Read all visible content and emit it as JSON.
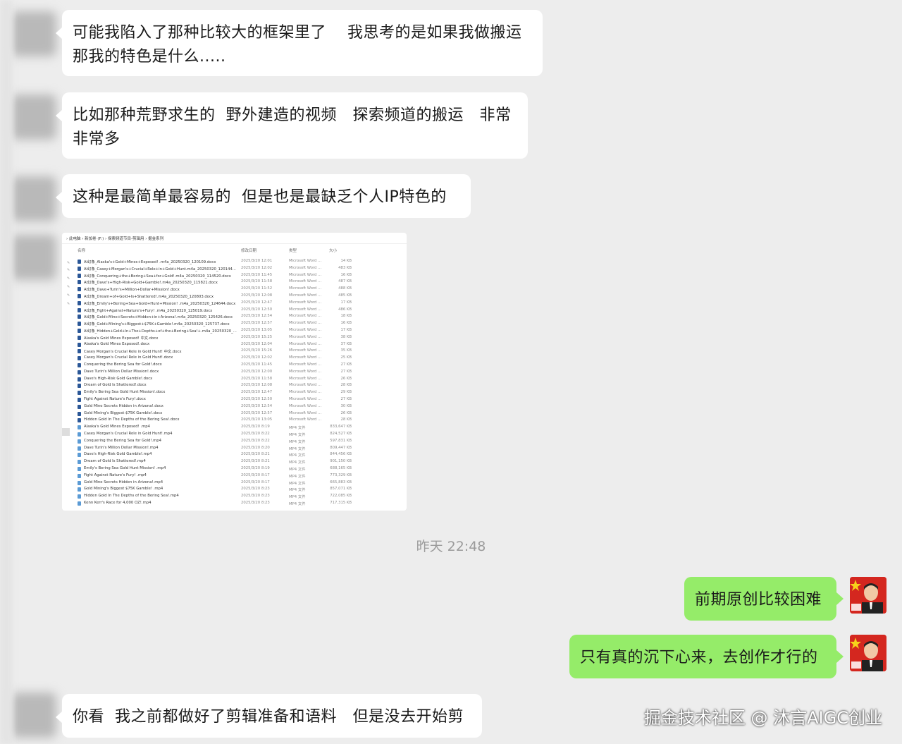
{
  "chat": {
    "messages_left_top": [
      {
        "text": "可能我陷入了那种比较大的框架里了    我思考的是如果我做搬运\n那我的特色是什么....."
      },
      {
        "text": "比如那种荒野求生的  野外建造的视频   探索频道的搬运   非常\n非常多"
      },
      {
        "text": "这种是最简单最容易的  但是也是最缺乏个人IP特色的"
      }
    ],
    "timestamp": "昨天 22:48",
    "messages_right": [
      {
        "text": "前期原创比较困难"
      },
      {
        "text": "只有真的沉下心来，去创作才行的"
      }
    ],
    "message_left_bottom": {
      "text": "你看  我之前都做好了剪辑准备和语料   但是没去开始剪"
    },
    "watermark": "掘金技术社区 @ 沐言AIGC创业"
  },
  "explorer": {
    "breadcrumb": "›  此电脑  ›  新加卷 (F:)  ›  探索频道节目-剪辑用  ›  掘金系列",
    "headers": {
      "name": "名称",
      "date": "修改日期",
      "type": "类型",
      "size": "大小"
    },
    "rows": [
      {
        "name": "AI幻象_Alaska's+Gold+Mines+Exposed! .m4a_20250320_120109.docx",
        "date": "2025/3/20 12:01",
        "type": "Microsoft Word ...",
        "size": "14 KB",
        "kind": "docx"
      },
      {
        "name": "AI幻象_Casey+Morgan's+Crucial+Role+in+Gold+Hunt.m4a_20250320_120144...",
        "date": "2025/3/20 12:02",
        "type": "Microsoft Word ...",
        "size": "483 KB",
        "kind": "docx"
      },
      {
        "name": "AI幻象_Conquering+the+Bering+Sea+for+Gold!.m4a_20250320_114520.docx",
        "date": "2025/3/20 11:45",
        "type": "Microsoft Word ...",
        "size": "16 KB",
        "kind": "docx"
      },
      {
        "name": "AI幻象_Dave's+High-Risk+Gold+Gamble!.m4a_20250320_115821.docx",
        "date": "2025/3/20 11:58",
        "type": "Microsoft Word ...",
        "size": "487 KB",
        "kind": "docx"
      },
      {
        "name": "AI幻象_Dave+Turin's+Million+Dollar+Mission!.docx",
        "date": "2025/3/20 11:52",
        "type": "Microsoft Word ...",
        "size": "488 KB",
        "kind": "docx"
      },
      {
        "name": "AI幻象_Dream+of+Gold+Is+Shattered!.m4a_20250320_120803.docx",
        "date": "2025/3/20 12:08",
        "type": "Microsoft Word ...",
        "size": "485 KB",
        "kind": "docx"
      },
      {
        "name": "AI幻象_Emily's+Bering+Sea+Gold+Hunt+Mission! .m4a_20250320_124644.docx",
        "date": "2025/3/20 12:47",
        "type": "Microsoft Word ...",
        "size": "17 KB",
        "kind": "docx"
      },
      {
        "name": "AI幻象_Fight+Against+Nature's+Fury! .m4a_20250320_125019.docx",
        "date": "2025/3/20 12:50",
        "type": "Microsoft Word ...",
        "size": "486 KB",
        "kind": "docx"
      },
      {
        "name": "AI幻象_Gold+Mine+Secrets+Hidden+in+Arizona!.m4a_20250320_125426.docx",
        "date": "2025/3/20 12:54",
        "type": "Microsoft Word ...",
        "size": "18 KB",
        "kind": "docx"
      },
      {
        "name": "AI幻象_Gold+Mining's+Biggest+$75K+Gamble!.m4a_20250320_125737.docx",
        "date": "2025/3/20 12:57",
        "type": "Microsoft Word ...",
        "size": "16 KB",
        "kind": "docx"
      },
      {
        "name": "AI幻象_Hidden+Gold+In+The+Depths+of+the+Bering+Sea!+.m4a_20250320_...",
        "date": "2025/3/20 13:05",
        "type": "Microsoft Word ...",
        "size": "17 KB",
        "kind": "docx"
      },
      {
        "name": "Alaska's Gold Mines Exposed! 中文.docx",
        "date": "2025/3/20 15:25",
        "type": "Microsoft Word ...",
        "size": "38 KB",
        "kind": "docx"
      },
      {
        "name": "Alaska's Gold Mines Exposed!.docx",
        "date": "2025/3/20 12:04",
        "type": "Microsoft Word ...",
        "size": "37 KB",
        "kind": "docx"
      },
      {
        "name": "Casey Morgan's Crucial Role in Gold Hunt! 中文.docx",
        "date": "2025/3/20 15:26",
        "type": "Microsoft Word ...",
        "size": "35 KB",
        "kind": "docx"
      },
      {
        "name": "Casey Morgan's Crucial Role in Gold Hunt!.docx",
        "date": "2025/3/20 12:02",
        "type": "Microsoft Word ...",
        "size": "25 KB",
        "kind": "docx"
      },
      {
        "name": "Conquering the Bering Sea for Gold!.docx",
        "date": "2025/3/20 11:45",
        "type": "Microsoft Word ...",
        "size": "27 KB",
        "kind": "docx"
      },
      {
        "name": "Dave Turin's Million Dollar Mission!.docx",
        "date": "2025/3/20 12:00",
        "type": "Microsoft Word ...",
        "size": "27 KB",
        "kind": "docx"
      },
      {
        "name": "Dave's High-Risk Gold Gamble!.docx",
        "date": "2025/3/20 11:58",
        "type": "Microsoft Word ...",
        "size": "26 KB",
        "kind": "docx"
      },
      {
        "name": "Dream of Gold Is Shattered!.docx",
        "date": "2025/3/20 12:08",
        "type": "Microsoft Word ...",
        "size": "28 KB",
        "kind": "docx"
      },
      {
        "name": "Emily's Bering Sea Gold Hunt Mission!.docx",
        "date": "2025/3/20 12:47",
        "type": "Microsoft Word ...",
        "size": "29 KB",
        "kind": "docx"
      },
      {
        "name": "Fight Against Nature's Fury!.docx",
        "date": "2025/3/20 12:50",
        "type": "Microsoft Word ...",
        "size": "27 KB",
        "kind": "docx"
      },
      {
        "name": "Gold Mine Secrets Hidden in Arizona!.docx",
        "date": "2025/3/20 12:54",
        "type": "Microsoft Word ...",
        "size": "30 KB",
        "kind": "docx"
      },
      {
        "name": "Gold Mining's Biggest $75K Gamble!.docx",
        "date": "2025/3/20 12:57",
        "type": "Microsoft Word ...",
        "size": "26 KB",
        "kind": "docx"
      },
      {
        "name": "Hidden Gold In The Depths of the Bering Sea!.docx",
        "date": "2025/3/20 13:05",
        "type": "Microsoft Word ...",
        "size": "28 KB",
        "kind": "docx"
      },
      {
        "name": "Alaska's Gold Mines Exposed! .mp4",
        "date": "2025/3/20 8:19",
        "type": "MP4 文件",
        "size": "833,647 KB",
        "kind": "mp4"
      },
      {
        "name": "Casey Morgan's Crucial Role in Gold Hunt!.mp4",
        "date": "2025/3/20 8:22",
        "type": "MP4 文件",
        "size": "824,527 KB",
        "kind": "mp4"
      },
      {
        "name": "Conquering the Bering Sea for Gold!.mp4",
        "date": "2025/3/20 8:22",
        "type": "MP4 文件",
        "size": "597,831 KB",
        "kind": "mp4"
      },
      {
        "name": "Dave Turin's Million Dollar Mission!.mp4",
        "date": "2025/3/20 8:20",
        "type": "MP4 文件",
        "size": "809,447 KB",
        "kind": "mp4"
      },
      {
        "name": "Dave's High-Risk Gold Gamble!.mp4",
        "date": "2025/3/20 8:21",
        "type": "MP4 文件",
        "size": "844,456 KB",
        "kind": "mp4"
      },
      {
        "name": "Dream of Gold Is Shattered!.mp4",
        "date": "2025/3/20 8:21",
        "type": "MP4 文件",
        "size": "901,150 KB",
        "kind": "mp4"
      },
      {
        "name": "Emily's Bering Sea Gold Hunt Mission! .mp4",
        "date": "2025/3/20 8:19",
        "type": "MP4 文件",
        "size": "688,165 KB",
        "kind": "mp4"
      },
      {
        "name": "Fight Against Nature's Fury! .mp4",
        "date": "2025/3/20 8:17",
        "type": "MP4 文件",
        "size": "773,329 KB",
        "kind": "mp4"
      },
      {
        "name": "Gold Mine Secrets Hidden in Arizona!.mp4",
        "date": "2025/3/20 8:17",
        "type": "MP4 文件",
        "size": "665,883 KB",
        "kind": "mp4"
      },
      {
        "name": "Gold Mining's Biggest $75K Gamble! .mp4",
        "date": "2025/3/20 8:23",
        "type": "MP4 文件",
        "size": "857,071 KB",
        "kind": "mp4"
      },
      {
        "name": "Hidden Gold In The Depths of the Bering Sea!.mp4",
        "date": "2025/3/20 8:23",
        "type": "MP4 文件",
        "size": "722,085 KB",
        "kind": "mp4"
      },
      {
        "name": "Kenn Kerr's Race for 4,000 OZ!.mp4",
        "date": "2025/3/20 8:23",
        "type": "MP4 文件",
        "size": "717,315 KB",
        "kind": "mp4"
      }
    ]
  },
  "colors": {
    "background": "#ededed",
    "bubble_left": "#ffffff",
    "bubble_right": "#95ec69",
    "docx_icon": "#2b5797",
    "mp4_icon": "#5b9bd5"
  },
  "icons": {
    "avatar_self": "avatar-flag-kid",
    "avatar_other": "avatar-blurred"
  }
}
